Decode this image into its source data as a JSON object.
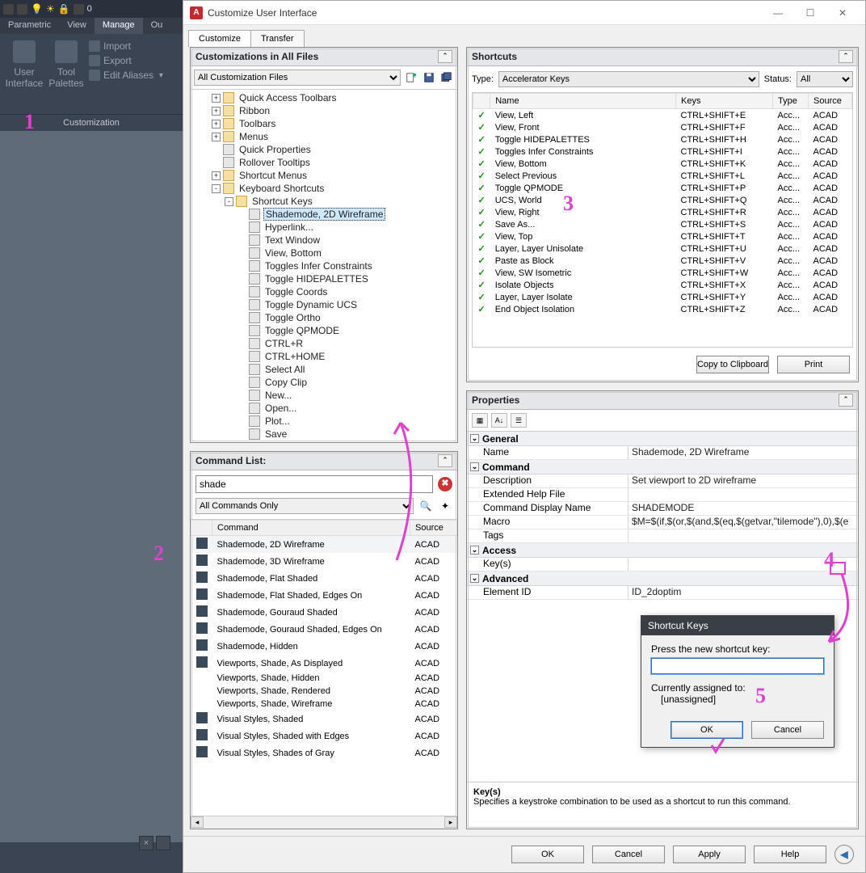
{
  "host": {
    "zero": "0",
    "tabs": [
      "Parametric",
      "View",
      "Manage",
      "Ou"
    ],
    "active_tab": "Manage",
    "ribbon": {
      "user_interface": "User\nInterface",
      "tool_palettes": "Tool\nPalettes",
      "import": "Import",
      "export": "Export",
      "edit_aliases": "Edit Aliases",
      "panel": "Customization"
    }
  },
  "cui": {
    "title": "Customize User Interface",
    "tabs": {
      "customize": "Customize",
      "transfer": "Transfer"
    },
    "customizations": {
      "title": "Customizations in All Files",
      "filter": "All Customization Files",
      "tree": [
        {
          "d": 1,
          "exp": "+",
          "icon": "folder",
          "label": "Quick Access Toolbars"
        },
        {
          "d": 1,
          "exp": "+",
          "icon": "folder",
          "label": "Ribbon"
        },
        {
          "d": 1,
          "exp": "+",
          "icon": "folder",
          "label": "Toolbars"
        },
        {
          "d": 1,
          "exp": "+",
          "icon": "folder",
          "label": "Menus"
        },
        {
          "d": 1,
          "exp": "",
          "icon": "key",
          "label": "Quick Properties"
        },
        {
          "d": 1,
          "exp": "",
          "icon": "key",
          "label": "Rollover Tooltips"
        },
        {
          "d": 1,
          "exp": "+",
          "icon": "folder",
          "label": "Shortcut Menus"
        },
        {
          "d": 1,
          "exp": "-",
          "icon": "folder",
          "label": "Keyboard Shortcuts"
        },
        {
          "d": 2,
          "exp": "-",
          "icon": "folder",
          "label": "Shortcut Keys"
        },
        {
          "d": 3,
          "exp": "",
          "icon": "key",
          "label": "Shademode, 2D Wireframe",
          "sel": true
        },
        {
          "d": 3,
          "exp": "",
          "icon": "key",
          "label": "Hyperlink..."
        },
        {
          "d": 3,
          "exp": "",
          "icon": "key",
          "label": "Text Window"
        },
        {
          "d": 3,
          "exp": "",
          "icon": "key",
          "label": "View, Bottom"
        },
        {
          "d": 3,
          "exp": "",
          "icon": "key",
          "label": "Toggles Infer Constraints"
        },
        {
          "d": 3,
          "exp": "",
          "icon": "key",
          "label": "Toggle HIDEPALETTES"
        },
        {
          "d": 3,
          "exp": "",
          "icon": "key",
          "label": "Toggle Coords"
        },
        {
          "d": 3,
          "exp": "",
          "icon": "key",
          "label": "Toggle Dynamic UCS"
        },
        {
          "d": 3,
          "exp": "",
          "icon": "key",
          "label": "Toggle Ortho"
        },
        {
          "d": 3,
          "exp": "",
          "icon": "key",
          "label": "Toggle QPMODE"
        },
        {
          "d": 3,
          "exp": "",
          "icon": "key",
          "label": "CTRL+R"
        },
        {
          "d": 3,
          "exp": "",
          "icon": "key",
          "label": "CTRL+HOME"
        },
        {
          "d": 3,
          "exp": "",
          "icon": "key",
          "label": "Select All"
        },
        {
          "d": 3,
          "exp": "",
          "icon": "key",
          "label": "Copy Clip"
        },
        {
          "d": 3,
          "exp": "",
          "icon": "key",
          "label": "New..."
        },
        {
          "d": 3,
          "exp": "",
          "icon": "key",
          "label": "Open..."
        },
        {
          "d": 3,
          "exp": "",
          "icon": "key",
          "label": "Plot..."
        },
        {
          "d": 3,
          "exp": "",
          "icon": "key",
          "label": "Save"
        }
      ]
    },
    "command_list": {
      "title": "Command List:",
      "search_value": "shade",
      "filter": "All Commands Only",
      "cols": {
        "command": "Command",
        "source": "Source"
      },
      "rows": [
        {
          "c": "Shademode, 2D Wireframe",
          "s": "ACAD",
          "sel": true,
          "ic": true
        },
        {
          "c": "Shademode, 3D Wireframe",
          "s": "ACAD",
          "ic": true
        },
        {
          "c": "Shademode, Flat Shaded",
          "s": "ACAD",
          "ic": true
        },
        {
          "c": "Shademode, Flat Shaded, Edges On",
          "s": "ACAD",
          "ic": true
        },
        {
          "c": "Shademode, Gouraud Shaded",
          "s": "ACAD",
          "ic": true
        },
        {
          "c": "Shademode, Gouraud Shaded, Edges On",
          "s": "ACAD",
          "ic": true
        },
        {
          "c": "Shademode, Hidden",
          "s": "ACAD",
          "ic": true
        },
        {
          "c": "Viewports, Shade, As Displayed",
          "s": "ACAD",
          "ic": true
        },
        {
          "c": "Viewports, Shade, Hidden",
          "s": "ACAD",
          "ic": false
        },
        {
          "c": "Viewports, Shade, Rendered",
          "s": "ACAD",
          "ic": false
        },
        {
          "c": "Viewports, Shade, Wireframe",
          "s": "ACAD",
          "ic": false
        },
        {
          "c": "Visual Styles, Shaded",
          "s": "ACAD",
          "ic": true
        },
        {
          "c": "Visual Styles, Shaded with Edges",
          "s": "ACAD",
          "ic": true
        },
        {
          "c": "Visual Styles, Shades of Gray",
          "s": "ACAD",
          "ic": true
        }
      ]
    },
    "shortcuts_panel": {
      "title": "Shortcuts",
      "type_label": "Type:",
      "type_value": "Accelerator Keys",
      "status_label": "Status:",
      "status_value": "All",
      "cols": {
        "name": "Name",
        "keys": "Keys",
        "type": "Type",
        "source": "Source"
      },
      "rows": [
        {
          "n": "View, Left",
          "k": "CTRL+SHIFT+E",
          "t": "Acc...",
          "s": "ACAD"
        },
        {
          "n": "View, Front",
          "k": "CTRL+SHIFT+F",
          "t": "Acc...",
          "s": "ACAD"
        },
        {
          "n": "Toggle HIDEPALETTES",
          "k": "CTRL+SHIFT+H",
          "t": "Acc...",
          "s": "ACAD"
        },
        {
          "n": "Toggles Infer Constraints",
          "k": "CTRL+SHIFT+I",
          "t": "Acc...",
          "s": "ACAD"
        },
        {
          "n": "View, Bottom",
          "k": "CTRL+SHIFT+K",
          "t": "Acc...",
          "s": "ACAD"
        },
        {
          "n": "Select Previous",
          "k": "CTRL+SHIFT+L",
          "t": "Acc...",
          "s": "ACAD"
        },
        {
          "n": "Toggle QPMODE",
          "k": "CTRL+SHIFT+P",
          "t": "Acc...",
          "s": "ACAD"
        },
        {
          "n": "UCS, World",
          "k": "CTRL+SHIFT+Q",
          "t": "Acc...",
          "s": "ACAD"
        },
        {
          "n": "View, Right",
          "k": "CTRL+SHIFT+R",
          "t": "Acc...",
          "s": "ACAD"
        },
        {
          "n": "Save As...",
          "k": "CTRL+SHIFT+S",
          "t": "Acc...",
          "s": "ACAD"
        },
        {
          "n": "View, Top",
          "k": "CTRL+SHIFT+T",
          "t": "Acc...",
          "s": "ACAD"
        },
        {
          "n": "Layer, Layer Unisolate",
          "k": "CTRL+SHIFT+U",
          "t": "Acc...",
          "s": "ACAD"
        },
        {
          "n": "Paste as Block",
          "k": "CTRL+SHIFT+V",
          "t": "Acc...",
          "s": "ACAD"
        },
        {
          "n": "View, SW Isometric",
          "k": "CTRL+SHIFT+W",
          "t": "Acc...",
          "s": "ACAD"
        },
        {
          "n": "Isolate Objects",
          "k": "CTRL+SHIFT+X",
          "t": "Acc...",
          "s": "ACAD"
        },
        {
          "n": "Layer, Layer Isolate",
          "k": "CTRL+SHIFT+Y",
          "t": "Acc...",
          "s": "ACAD"
        },
        {
          "n": "End Object Isolation",
          "k": "CTRL+SHIFT+Z",
          "t": "Acc...",
          "s": "ACAD"
        }
      ],
      "copy": "Copy to Clipboard",
      "print": "Print"
    },
    "properties": {
      "title": "Properties",
      "cats": [
        {
          "name": "General",
          "rows": [
            {
              "k": "Name",
              "v": "Shademode, 2D Wireframe"
            }
          ]
        },
        {
          "name": "Command",
          "rows": [
            {
              "k": "Description",
              "v": "Set viewport to 2D wireframe"
            },
            {
              "k": "Extended Help File",
              "v": ""
            },
            {
              "k": "Command Display Name",
              "v": "SHADEMODE"
            },
            {
              "k": "Macro",
              "v": "$M=$(if,$(or,$(and,$(eq,$(getvar,\"tilemode\"),0),$(e"
            },
            {
              "k": "Tags",
              "v": ""
            }
          ]
        },
        {
          "name": "Access",
          "rows": [
            {
              "k": "Key(s)",
              "v": ""
            }
          ]
        },
        {
          "name": "Advanced",
          "rows": [
            {
              "k": "Element ID",
              "v": "ID_2doptim"
            }
          ]
        }
      ],
      "desc_title": "Key(s)",
      "desc_text": "Specifies a keystroke combination to be used as a shortcut to run this command."
    },
    "footer": {
      "ok": "OK",
      "cancel": "Cancel",
      "apply": "Apply",
      "help": "Help"
    }
  },
  "skdialog": {
    "title": "Shortcut Keys",
    "prompt": "Press the new shortcut key:",
    "assigned_label": "Currently assigned to:",
    "assigned_value": "[unassigned]",
    "ok": "OK",
    "cancel": "Cancel"
  },
  "annotations": {
    "n1": "1",
    "n2": "2",
    "n3": "3",
    "n4": "4",
    "n5": "5"
  }
}
